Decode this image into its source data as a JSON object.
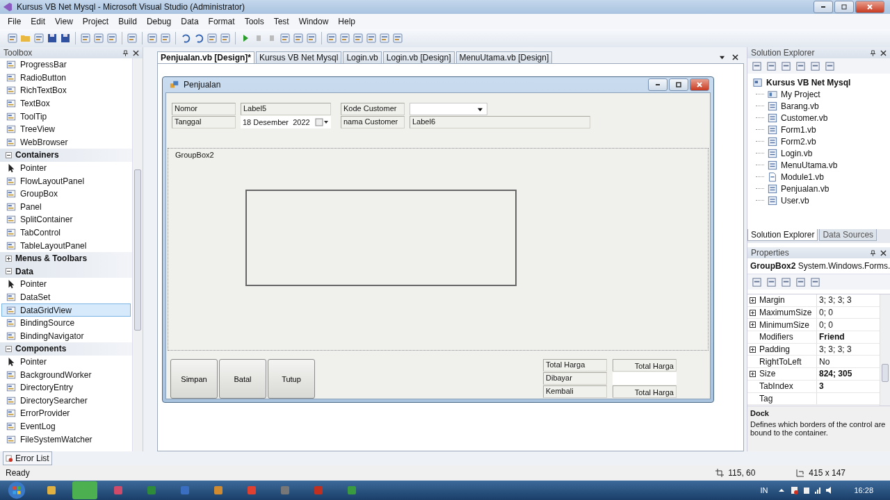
{
  "window": {
    "title": "Kursus VB Net Mysql - Microsoft Visual Studio (Administrator)"
  },
  "menu": [
    "File",
    "Edit",
    "View",
    "Project",
    "Build",
    "Debug",
    "Data",
    "Format",
    "Tools",
    "Test",
    "Window",
    "Help"
  ],
  "toolbox": {
    "title": "Toolbox",
    "entries": [
      {
        "kind": "item",
        "label": "ProgressBar",
        "selected": false
      },
      {
        "kind": "item",
        "label": "RadioButton",
        "selected": false
      },
      {
        "kind": "item",
        "label": "RichTextBox",
        "selected": false
      },
      {
        "kind": "item",
        "label": "TextBox",
        "selected": false
      },
      {
        "kind": "item",
        "label": "ToolTip",
        "selected": false
      },
      {
        "kind": "item",
        "label": "TreeView",
        "selected": false
      },
      {
        "kind": "item",
        "label": "WebBrowser",
        "selected": false
      },
      {
        "kind": "category",
        "label": "Containers",
        "expanded": true,
        "selected": false
      },
      {
        "kind": "pointer",
        "label": "Pointer",
        "selected": false
      },
      {
        "kind": "item",
        "label": "FlowLayoutPanel",
        "selected": false
      },
      {
        "kind": "item",
        "label": "GroupBox",
        "selected": false
      },
      {
        "kind": "item",
        "label": "Panel",
        "selected": false
      },
      {
        "kind": "item",
        "label": "SplitContainer",
        "selected": false
      },
      {
        "kind": "item",
        "label": "TabControl",
        "selected": false
      },
      {
        "kind": "item",
        "label": "TableLayoutPanel",
        "selected": false
      },
      {
        "kind": "category",
        "label": "Menus & Toolbars",
        "expanded": false,
        "selected": false
      },
      {
        "kind": "category",
        "label": "Data",
        "expanded": true,
        "selected": false
      },
      {
        "kind": "pointer",
        "label": "Pointer",
        "selected": false
      },
      {
        "kind": "item",
        "label": "DataSet",
        "selected": false
      },
      {
        "kind": "item",
        "label": "DataGridView",
        "selected": true
      },
      {
        "kind": "item",
        "label": "BindingSource",
        "selected": false
      },
      {
        "kind": "item",
        "label": "BindingNavigator",
        "selected": false
      },
      {
        "kind": "category",
        "label": "Components",
        "expanded": true,
        "selected": false
      },
      {
        "kind": "pointer",
        "label": "Pointer",
        "selected": false
      },
      {
        "kind": "item",
        "label": "BackgroundWorker",
        "selected": false
      },
      {
        "kind": "item",
        "label": "DirectoryEntry",
        "selected": false
      },
      {
        "kind": "item",
        "label": "DirectorySearcher",
        "selected": false
      },
      {
        "kind": "item",
        "label": "ErrorProvider",
        "selected": false
      },
      {
        "kind": "item",
        "label": "EventLog",
        "selected": false
      },
      {
        "kind": "item",
        "label": "FileSystemWatcher",
        "selected": false
      }
    ]
  },
  "error_list": "Error List",
  "tabs": [
    {
      "label": "Penjualan.vb [Design]*",
      "selected": true
    },
    {
      "label": "Kursus VB Net Mysql",
      "selected": false
    },
    {
      "label": "Login.vb",
      "selected": false
    },
    {
      "label": "Login.vb [Design]",
      "selected": false
    },
    {
      "label": "MenuUtama.vb [Design]",
      "selected": false
    }
  ],
  "form": {
    "title": "Penjualan",
    "left_fields": [
      {
        "label": "Nomor",
        "kind": "label",
        "value": "Label5"
      },
      {
        "label": "Tanggal",
        "kind": "date",
        "value": "18 Desember  2022"
      }
    ],
    "right_fields": [
      {
        "label": "Kode Customer",
        "kind": "combo"
      },
      {
        "label": "nama Customer",
        "kind": "label",
        "value": "Label6"
      }
    ],
    "groupbox": "GroupBox2",
    "buttons": [
      "Simpan",
      "Batal",
      "Tutup"
    ],
    "totals": [
      {
        "label": "Total Harga",
        "kind": "label",
        "value": "Total Harga"
      },
      {
        "label": "Dibayar",
        "kind": "textbox"
      },
      {
        "label": "Kembali",
        "kind": "label",
        "value": "Total Harga"
      }
    ]
  },
  "solution_explorer": {
    "title": "Solution Explorer",
    "root": "Kursus VB Net Mysql",
    "children": [
      {
        "kind": "project",
        "label": "My Project"
      },
      {
        "kind": "form",
        "label": "Barang.vb"
      },
      {
        "kind": "form",
        "label": "Customer.vb"
      },
      {
        "kind": "form",
        "label": "Form1.vb"
      },
      {
        "kind": "form",
        "label": "Form2.vb"
      },
      {
        "kind": "form",
        "label": "Login.vb"
      },
      {
        "kind": "form",
        "label": "MenuUtama.vb"
      },
      {
        "kind": "module",
        "label": "Module1.vb"
      },
      {
        "kind": "form",
        "label": "Penjualan.vb"
      },
      {
        "kind": "form",
        "label": "User.vb"
      }
    ],
    "tabs": [
      {
        "label": "Solution Explorer",
        "selected": true
      },
      {
        "label": "Data Sources",
        "selected": false
      }
    ]
  },
  "properties": {
    "title": "Properties",
    "object": "GroupBox2",
    "type": "System.Windows.Forms.",
    "rows": [
      {
        "name": "Margin",
        "value": "3; 3; 3; 3",
        "expandable": true,
        "modified": false
      },
      {
        "name": "MaximumSize",
        "value": "0; 0",
        "expandable": true,
        "modified": false
      },
      {
        "name": "MinimumSize",
        "value": "0; 0",
        "expandable": true,
        "modified": false
      },
      {
        "name": "Modifiers",
        "value": "Friend",
        "expandable": false,
        "modified": true
      },
      {
        "name": "Padding",
        "value": "3; 3; 3; 3",
        "expandable": true,
        "modified": false
      },
      {
        "name": "RightToLeft",
        "value": "No",
        "expandable": false,
        "modified": false
      },
      {
        "name": "Size",
        "value": "824; 305",
        "expandable": true,
        "modified": true
      },
      {
        "name": "TabIndex",
        "value": "3",
        "expandable": false,
        "modified": true
      },
      {
        "name": "Tag",
        "expandable": false
      }
    ],
    "description_title": "Dock",
    "description": "Defines which borders of the control are bound to the container."
  },
  "status_bar": {
    "text": "Ready",
    "position": "115, 60",
    "size": "415 x 147"
  },
  "taskbar": {
    "language": "IN",
    "time": "16:28"
  }
}
